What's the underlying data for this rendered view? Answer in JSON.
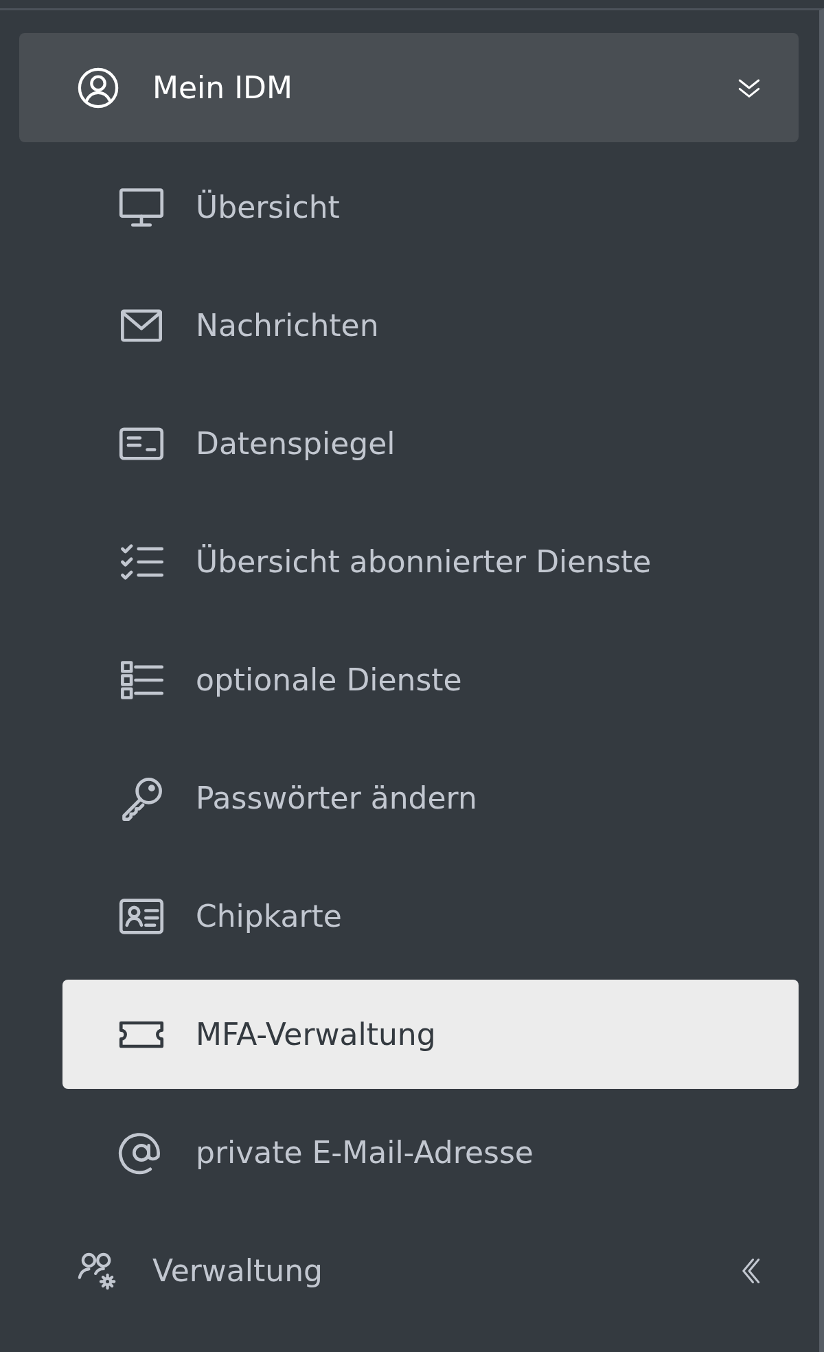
{
  "sidebar": {
    "groups": [
      {
        "label": "Mein IDM",
        "expanded": true,
        "children": [
          {
            "label": "Übersicht",
            "selected": false
          },
          {
            "label": "Nachrichten",
            "selected": false
          },
          {
            "label": "Datenspiegel",
            "selected": false
          },
          {
            "label": "Übersicht abonnierter Dienste",
            "selected": false
          },
          {
            "label": "optionale Dienste",
            "selected": false
          },
          {
            "label": "Passwörter ändern",
            "selected": false
          },
          {
            "label": "Chipkarte",
            "selected": false
          },
          {
            "label": "MFA-Verwaltung",
            "selected": true
          },
          {
            "label": "private E-Mail-Adresse",
            "selected": false
          }
        ]
      },
      {
        "label": "Verwaltung",
        "expanded": false
      }
    ]
  }
}
